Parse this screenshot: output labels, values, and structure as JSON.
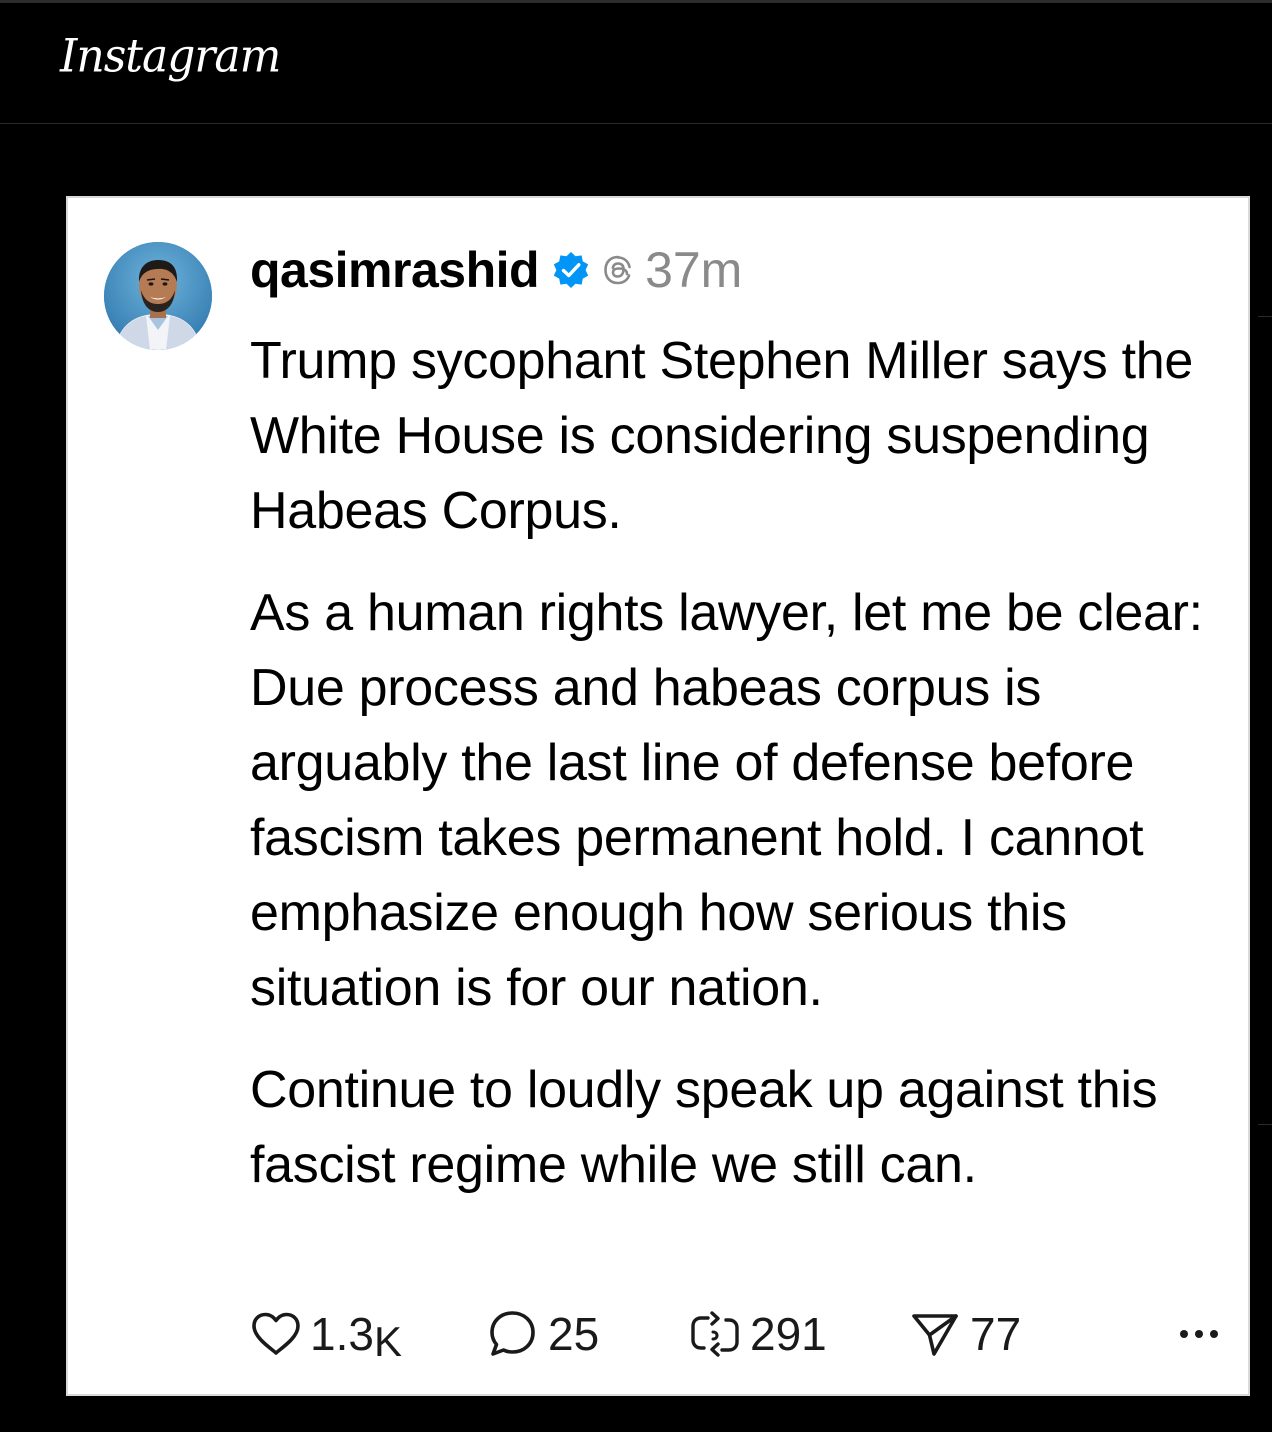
{
  "app": {
    "name": "Instagram"
  },
  "post": {
    "username": "qasimrashid",
    "time": "37m",
    "paragraphs": [
      "Trump sycophant Stephen Miller says the White House is considering suspending Habeas Corpus.",
      "As a human rights lawyer, let me be clear: Due process and habeas corpus is arguably the last line of defense before fascism takes permanent hold. I cannot emphasize enough how serious this situation is for our nation.",
      "Continue to loudly speak up against this fascist regime while we still can."
    ],
    "stats": {
      "likes_number": "1.3",
      "likes_unit": "K",
      "comments": "25",
      "reposts": "291",
      "shares": "77"
    }
  },
  "icons": {
    "verified": "verified-badge-icon",
    "threads": "threads-logo-icon",
    "like": "heart-icon",
    "comment": "speech-bubble-icon",
    "repost": "repost-icon",
    "share": "send-icon",
    "more": "ellipsis-icon"
  },
  "colors": {
    "background": "#000000",
    "card": "#ffffff",
    "verified": "#0095f6",
    "timestamp": "#8a8a8a"
  }
}
